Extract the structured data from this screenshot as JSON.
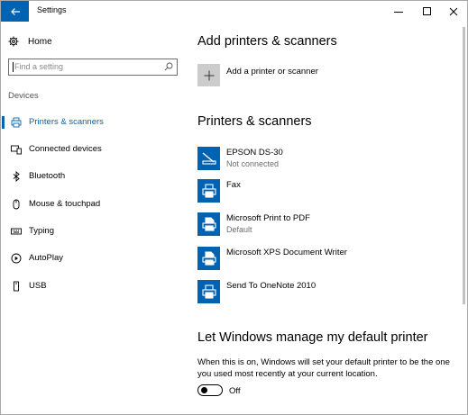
{
  "window": {
    "title": "Settings",
    "accent": "#0063b1",
    "controls": [
      "minimize-icon",
      "maximize-icon",
      "close-icon"
    ]
  },
  "sidebar": {
    "home_label": "Home",
    "search_placeholder": "Find a setting",
    "section_title": "Devices",
    "items": [
      {
        "label": "Printers & scanners",
        "icon": "printer-icon",
        "active": true
      },
      {
        "label": "Connected devices",
        "icon": "devices-icon",
        "active": false
      },
      {
        "label": "Bluetooth",
        "icon": "bluetooth-icon",
        "active": false
      },
      {
        "label": "Mouse & touchpad",
        "icon": "mouse-icon",
        "active": false
      },
      {
        "label": "Typing",
        "icon": "keyboard-icon",
        "active": false
      },
      {
        "label": "AutoPlay",
        "icon": "autoplay-icon",
        "active": false
      },
      {
        "label": "USB",
        "icon": "usb-icon",
        "active": false
      }
    ]
  },
  "main": {
    "add_heading": "Add printers & scanners",
    "add_label": "Add a printer or scanner",
    "list_heading": "Printers & scanners",
    "printers": [
      {
        "name": "EPSON DS-30",
        "status": "Not connected",
        "icon": "scanner-icon"
      },
      {
        "name": "Fax",
        "status": "",
        "icon": "printer-icon"
      },
      {
        "name": "Microsoft Print to PDF",
        "status": "Default",
        "icon": "printer-icon"
      },
      {
        "name": "Microsoft XPS Document Writer",
        "status": "",
        "icon": "printer-icon"
      },
      {
        "name": "Send To OneNote 2010",
        "status": "",
        "icon": "printer-icon"
      }
    ],
    "default_heading": "Let Windows manage my default printer",
    "default_description": "When this is on, Windows will set your default printer to be the one you used most recently at your current location.",
    "toggle_state": "Off"
  }
}
